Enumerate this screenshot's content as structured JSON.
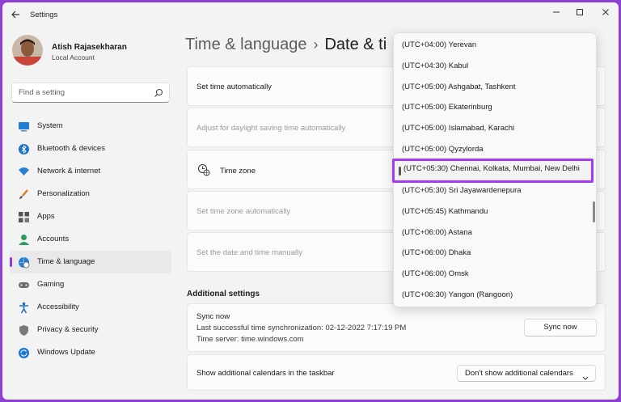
{
  "app": {
    "title": "Settings"
  },
  "user": {
    "name": "Atish Rajasekharan",
    "account": "Local Account"
  },
  "search": {
    "placeholder": "Find a setting"
  },
  "nav": {
    "items": [
      {
        "label": "System",
        "icon": "monitor-icon"
      },
      {
        "label": "Bluetooth & devices",
        "icon": "bluetooth-icon"
      },
      {
        "label": "Network & internet",
        "icon": "wifi-icon"
      },
      {
        "label": "Personalization",
        "icon": "brush-icon"
      },
      {
        "label": "Apps",
        "icon": "apps-icon"
      },
      {
        "label": "Accounts",
        "icon": "person-icon"
      },
      {
        "label": "Time & language",
        "icon": "globe-clock-icon",
        "active": true
      },
      {
        "label": "Gaming",
        "icon": "gamepad-icon"
      },
      {
        "label": "Accessibility",
        "icon": "accessibility-icon"
      },
      {
        "label": "Privacy & security",
        "icon": "shield-icon"
      },
      {
        "label": "Windows Update",
        "icon": "update-icon"
      }
    ]
  },
  "breadcrumb": {
    "parent": "Time & language",
    "separator": "›",
    "current": "Date & ti"
  },
  "settings": {
    "set_time_auto": "Set time automatically",
    "dst_auto": "Adjust for daylight saving time automatically",
    "time_zone": "Time zone",
    "tz_auto": "Set time zone automatically",
    "manual": "Set the date and time manually"
  },
  "additional": {
    "title": "Additional settings",
    "sync_title": "Sync now",
    "sync_last": "Last successful time synchronization: 02-12-2022 7:17:19 PM",
    "sync_server": "Time server: time.windows.com",
    "sync_button": "Sync now",
    "calendars_label": "Show additional calendars in the taskbar",
    "calendars_value": "Don't show additional calendars"
  },
  "timezones": {
    "items": [
      "(UTC+04:00) Yerevan",
      "(UTC+04:30) Kabul",
      "(UTC+05:00) Ashgabat, Tashkent",
      "(UTC+05:00) Ekaterinburg",
      "(UTC+05:00) Islamabad, Karachi",
      "(UTC+05:00) Qyzylorda",
      "(UTC+05:30) Chennai, Kolkata, Mumbai, New Delhi",
      "(UTC+05:30) Sri Jayawardenepura",
      "(UTC+05:45) Kathmandu",
      "(UTC+06:00) Astana",
      "(UTC+06:00) Dhaka",
      "(UTC+06:00) Omsk",
      "(UTC+06:30) Yangon (Rangoon)"
    ],
    "selected_index": 6
  },
  "colors": {
    "accent": "#8a3fcf",
    "highlight": "#a33bf0",
    "background": "#8e3fd3"
  }
}
